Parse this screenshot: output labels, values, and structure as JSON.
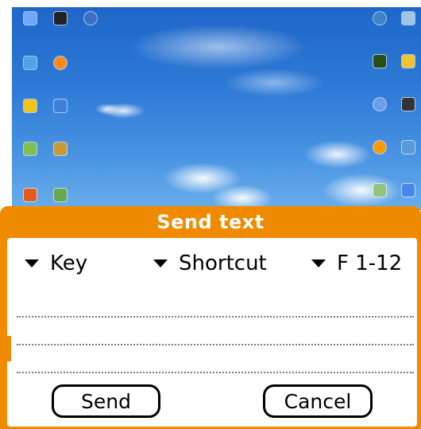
{
  "dialog": {
    "title": "Send text",
    "dropdowns": [
      {
        "label": "Key"
      },
      {
        "label": "Shortcut"
      },
      {
        "label": "F 1-12"
      }
    ],
    "input_value": "",
    "send_label": "Send",
    "cancel_label": "Cancel",
    "accent_color": "#f08a00"
  },
  "desktop": {
    "icons": [
      {
        "name": "desktop-icon-1",
        "color": "#6fa8ff"
      },
      {
        "name": "desktop-icon-2",
        "color": "#222222"
      },
      {
        "name": "desktop-icon-3",
        "color": "#3a6fc7"
      },
      {
        "name": "desktop-icon-4",
        "color": "#4fa3e6"
      },
      {
        "name": "desktop-icon-5",
        "color": "#ff8c1a"
      },
      {
        "name": "desktop-icon-6",
        "color": "#f0c419"
      },
      {
        "name": "desktop-icon-7",
        "color": "#3e7fd8"
      },
      {
        "name": "desktop-icon-8",
        "color": "#7fbf4f"
      },
      {
        "name": "desktop-icon-9",
        "color": "#c79a36"
      },
      {
        "name": "desktop-icon-10",
        "color": "#e65a1e"
      },
      {
        "name": "desktop-icon-11",
        "color": "#6aa84f"
      },
      {
        "name": "desktop-icon-12",
        "color": "#3d85c6"
      },
      {
        "name": "desktop-icon-13",
        "color": "#9fc5e8"
      },
      {
        "name": "desktop-icon-14",
        "color": "#274e13"
      },
      {
        "name": "desktop-icon-15",
        "color": "#f1c232"
      },
      {
        "name": "desktop-icon-16",
        "color": "#6d9eeb"
      },
      {
        "name": "desktop-icon-17",
        "color": "#333333"
      },
      {
        "name": "desktop-icon-18",
        "color": "#ff9900"
      },
      {
        "name": "desktop-icon-19",
        "color": "#5b9bd5"
      },
      {
        "name": "desktop-icon-20",
        "color": "#93c47d"
      },
      {
        "name": "desktop-icon-21",
        "color": "#4a86e8"
      }
    ]
  }
}
